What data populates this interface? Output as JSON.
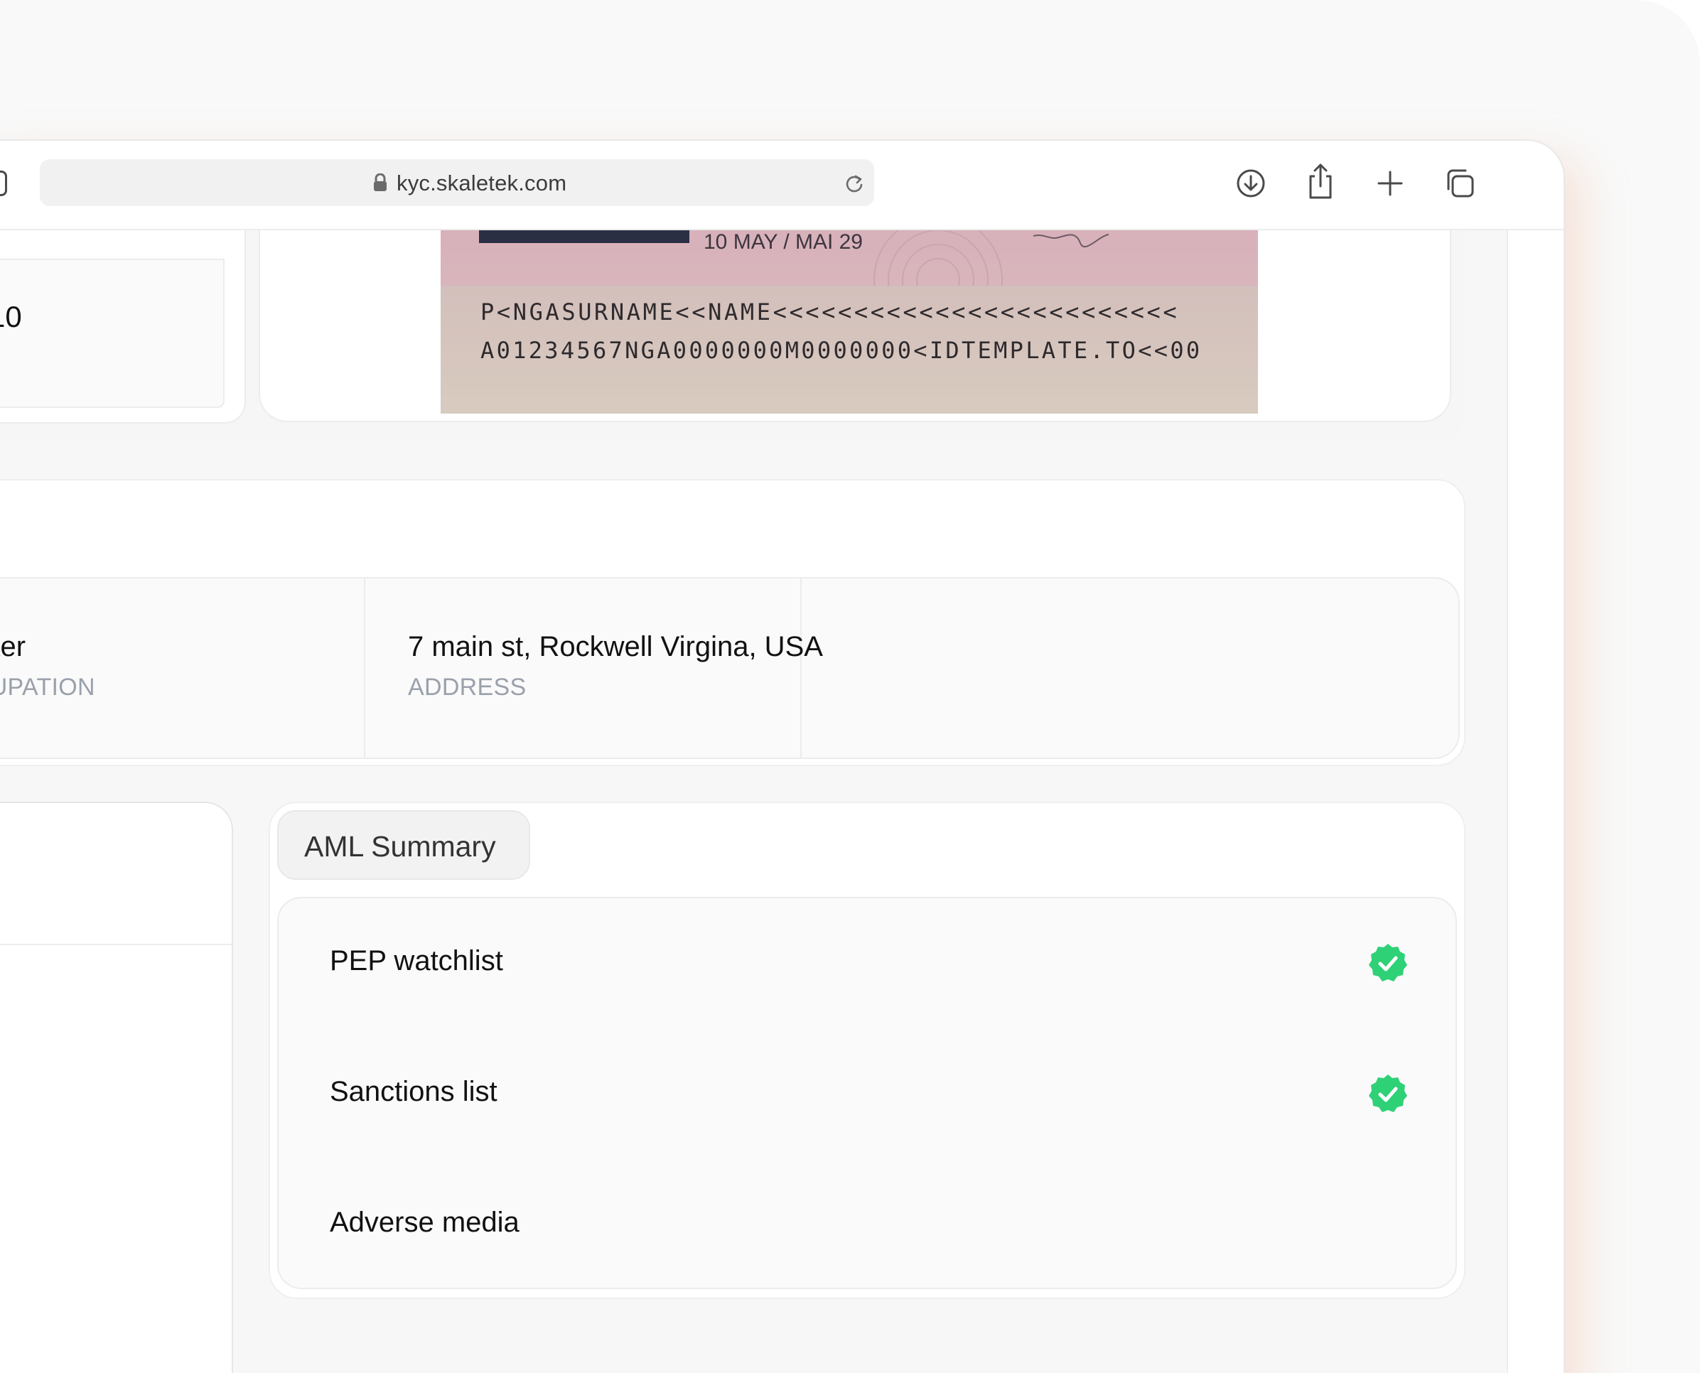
{
  "browser": {
    "url": "kyc.skaletek.com",
    "icons": [
      "sidebar-icon",
      "lock-icon",
      "reload-icon",
      "download-icon",
      "share-icon",
      "new-tab-icon",
      "tabs-overview-icon"
    ]
  },
  "document": {
    "expiry_text": "10 MAY / MAI 29",
    "mrz_line_1": "P<NGASURNAME<<NAME<<<<<<<<<<<<<<<<<<<<<<<<<",
    "mrz_line_2": "A01234567NGA0000000M0000000<IDTEMPLATE.TO<<00",
    "partial_field_value": "10"
  },
  "profile": {
    "occupation": {
      "value": "anker",
      "label": "CCUPATION"
    },
    "address": {
      "value": "7 main st, Rockwell Virgina, USA",
      "label": "ADDRESS"
    }
  },
  "aml": {
    "title": "AML Summary",
    "items": [
      {
        "label": "PEP watchlist",
        "status": "passed",
        "icon": "check-badge-icon"
      },
      {
        "label": "Sanctions list",
        "status": "passed",
        "icon": "check-badge-icon"
      },
      {
        "label": "Adverse media",
        "status": "none",
        "icon": ""
      }
    ]
  },
  "colors": {
    "success_green": "#2fd177",
    "label_gray": "#9aa1ab",
    "passport_pink": "#d9b5bd"
  }
}
